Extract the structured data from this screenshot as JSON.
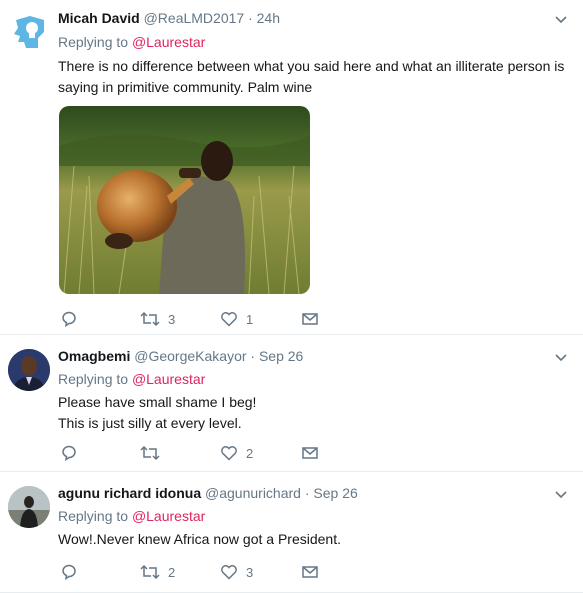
{
  "tweets": [
    {
      "name": "Micah David",
      "handle": "@ReaLMD2017",
      "time": "· 24h",
      "reply_prefix": "Replying to",
      "reply_to": "@Laurestar",
      "lines": [
        "There is no difference between what you said here and what an illiterate person is",
        "saying in  primitive community. Palm wine"
      ],
      "avatar": "default-egg-avatar",
      "has_photo": true,
      "retweets": "3",
      "likes": "1",
      "replies": ""
    },
    {
      "name": "Omagbemi",
      "handle": "@GeorgeKakayor",
      "time": "· Sep 26",
      "reply_prefix": "Replying to",
      "reply_to": "@Laurestar",
      "lines": [
        "Please have small shame I beg!",
        "This is just silly at every level."
      ],
      "avatar": "profile-photo",
      "has_photo": false,
      "retweets": "",
      "likes": "2",
      "replies": ""
    },
    {
      "name": "agunu richard idonua",
      "handle": "@agunurichard",
      "time": "· Sep 26",
      "reply_prefix": "Replying to",
      "reply_to": "@Laurestar",
      "lines": [
        "Wow!.Never knew Africa now got a President."
      ],
      "avatar": "profile-photo",
      "has_photo": false,
      "retweets": "2",
      "likes": "3",
      "replies": ""
    }
  ],
  "icons": {
    "reply": "reply-icon",
    "retweet": "retweet-icon",
    "like": "heart-icon",
    "dm": "envelope-icon",
    "caret": "chevron-down-icon"
  },
  "colors": {
    "mention": "#e0245e",
    "muted": "#657786",
    "divider": "#e6ecf0",
    "egg_avatar": "#5eb6e4"
  }
}
